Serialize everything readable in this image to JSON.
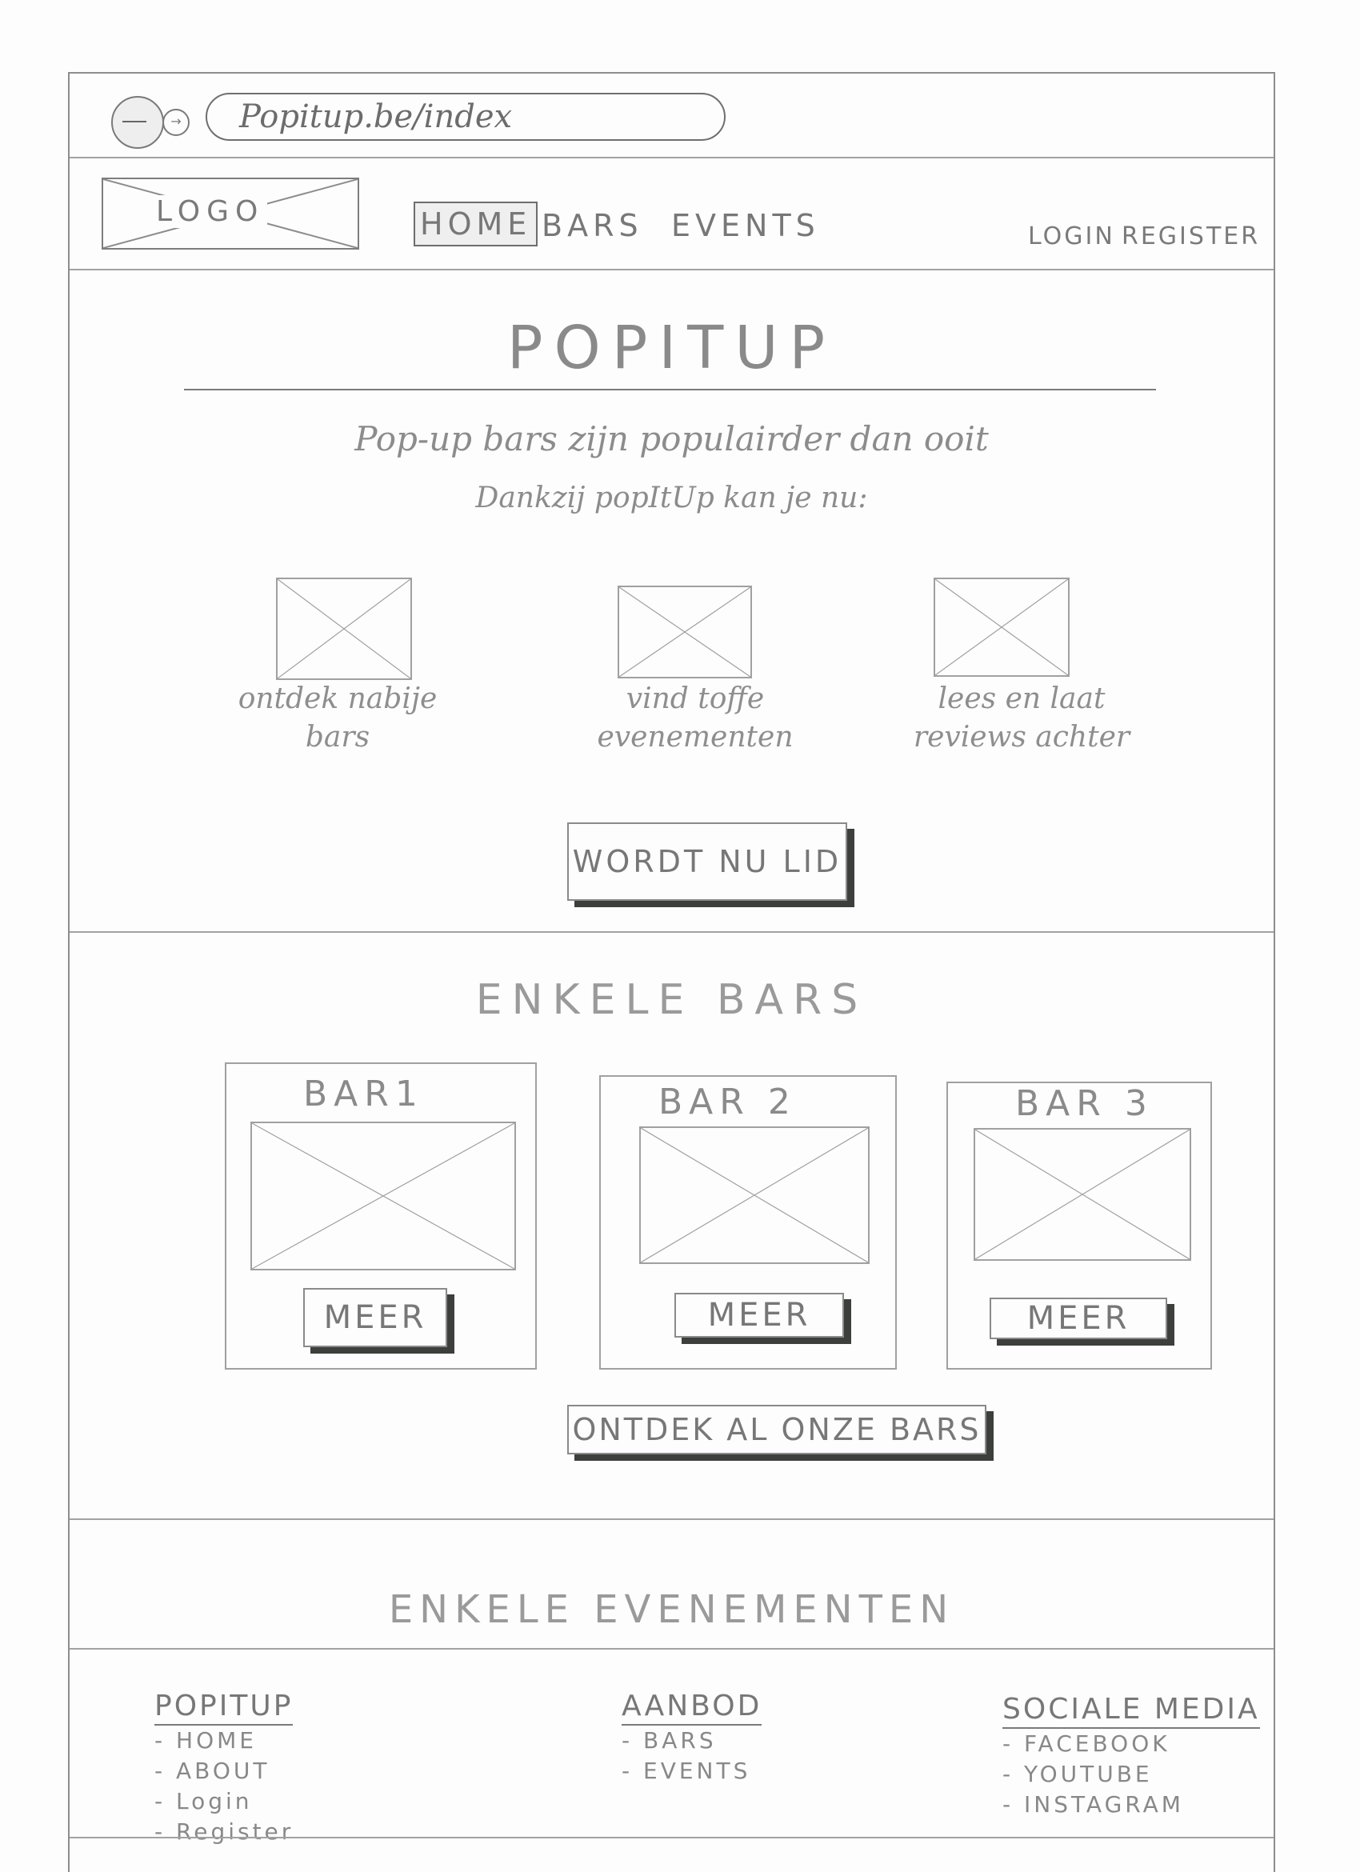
{
  "browser": {
    "url": "Popitup.be/index"
  },
  "nav": {
    "logo": "LOGO",
    "items": [
      {
        "label": "HOME",
        "active": true
      },
      {
        "label": "BARS",
        "active": false
      },
      {
        "label": "EVENTS",
        "active": false
      }
    ],
    "login": "LOGIN",
    "register": "REGISTER"
  },
  "hero": {
    "title": "POPITUP",
    "line1": "Pop-up bars zijn populairder dan ooit",
    "line2": "Dankzij popItUp kan je nu:",
    "features": [
      {
        "caption": "ontdek nabije bars"
      },
      {
        "caption": "vind toffe evenementen"
      },
      {
        "caption": "lees en laat reviews achter"
      }
    ],
    "cta": "WORDT NU LID"
  },
  "bars": {
    "title": "ENKELE BARS",
    "cards": [
      {
        "name": "BAR1",
        "button": "MEER"
      },
      {
        "name": "BAR 2",
        "button": "MEER"
      },
      {
        "name": "BAR 3",
        "button": "MEER"
      }
    ],
    "all_button": "ONTDEK AL ONZE BARS"
  },
  "events": {
    "title": "ENKELE EVENEMENTEN"
  },
  "footer": {
    "columns": [
      {
        "heading": "POPITUP",
        "links": [
          "HOME",
          "ABOUT",
          "Login",
          "Register"
        ]
      },
      {
        "heading": "AANBOD",
        "links": [
          "BARS",
          "EVENTS"
        ]
      },
      {
        "heading": "SOCIALE MEDIA",
        "links": [
          "FACEBOOK",
          "YOUTUBE",
          "INSTAGRAM"
        ]
      }
    ]
  },
  "colors": {
    "pencil": "#7a7a7a",
    "paper": "#fdfdfd",
    "shadow": "#3c3f3c"
  }
}
